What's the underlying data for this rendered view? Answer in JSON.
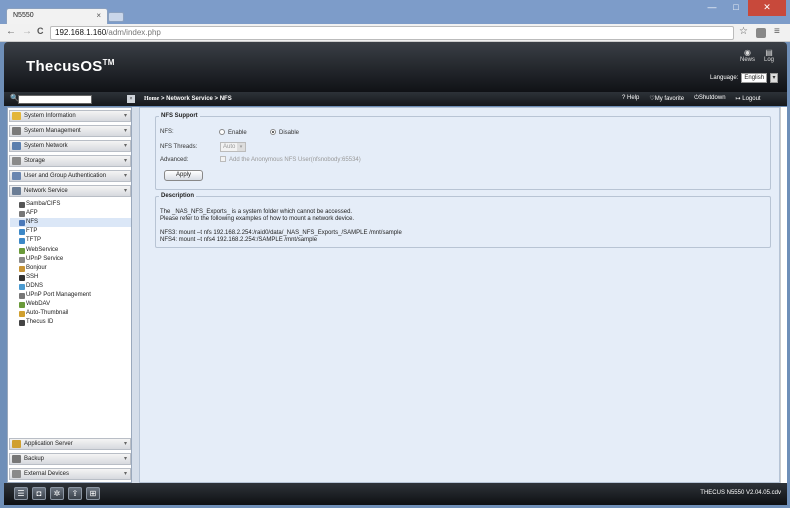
{
  "browser": {
    "tab_title": "N5550",
    "tab_close": "×",
    "url_host": "192.168.1.160",
    "url_path": "/adm/index.php",
    "back": "←",
    "forward": "→",
    "reload": "C",
    "star": "☆",
    "menu": "≡",
    "win_min": "—",
    "win_max": "□",
    "win_close": "✕"
  },
  "header": {
    "logo": "ThecusOS",
    "logo_tm": "TM",
    "news": "News",
    "log": "Log",
    "language_label": "Language:",
    "language_value": "English"
  },
  "topbar": {
    "breadcrumb_home": "Home",
    "breadcrumb_rest": "> Network Service > NFS",
    "help": "Help",
    "favorite": "My favorite",
    "shutdown": "Shutdown",
    "logout": "Logout"
  },
  "sidebar": {
    "categories_top": [
      {
        "label": "System Information",
        "color": "#e3b63a"
      },
      {
        "label": "System Management",
        "color": "#7a7a7a"
      },
      {
        "label": "System Network",
        "color": "#5b7fae"
      },
      {
        "label": "Storage",
        "color": "#8a8a8a"
      },
      {
        "label": "User and Group Authentication",
        "color": "#6a86b0"
      },
      {
        "label": "Network Service",
        "color": "#6b7d95"
      }
    ],
    "sub_items": [
      {
        "label": "Samba/CIFS",
        "color": "#555"
      },
      {
        "label": "AFP",
        "color": "#777"
      },
      {
        "label": "NFS",
        "color": "#4a78b8"
      },
      {
        "label": "FTP",
        "color": "#3d88c7"
      },
      {
        "label": "TFTP",
        "color": "#3d88c7"
      },
      {
        "label": "WebService",
        "color": "#6a9a3a"
      },
      {
        "label": "UPnP Service",
        "color": "#888"
      },
      {
        "label": "Bonjour",
        "color": "#c79436"
      },
      {
        "label": "SSH",
        "color": "#333"
      },
      {
        "label": "DDNS",
        "color": "#4a9ad0"
      },
      {
        "label": "UPnP Port Management",
        "color": "#777"
      },
      {
        "label": "WebDAV",
        "color": "#6a9a3a"
      },
      {
        "label": "Auto-Thumbnail",
        "color": "#d0a030"
      },
      {
        "label": "Thecus ID",
        "color": "#444"
      }
    ],
    "categories_bottom": [
      {
        "label": "Application Server",
        "color": "#d0a030"
      },
      {
        "label": "Backup",
        "color": "#777"
      },
      {
        "label": "External Devices",
        "color": "#8a8a8a"
      }
    ]
  },
  "nfs": {
    "legend": "NFS Support",
    "nfs_label": "NFS:",
    "enable": "Enable",
    "disable": "Disable",
    "threads_label": "NFS Threads:",
    "threads_value": "Auto",
    "advanced_label": "Advanced:",
    "anon_label": "Add the Anonymous NFS User(nfsnobody:65534)",
    "apply": "Apply"
  },
  "description": {
    "legend": "Description",
    "line1": "The _NAS_NFS_Exports_ is a system folder which cannot be accessed.",
    "line2": "Please refer to the following examples of how to mount a network device.",
    "line3": "NFS3: mount –t nfs 192.168.2.254:/raid0/data/_NAS_NFS_Exports_/SAMPLE   /mnt/sample",
    "line4": "NFS4: mount –t nfs4 192.168.2.254:/SAMPLE   /mnt/sample"
  },
  "footer": {
    "version": "THECUS N5550 V2.04.05.cdv"
  }
}
